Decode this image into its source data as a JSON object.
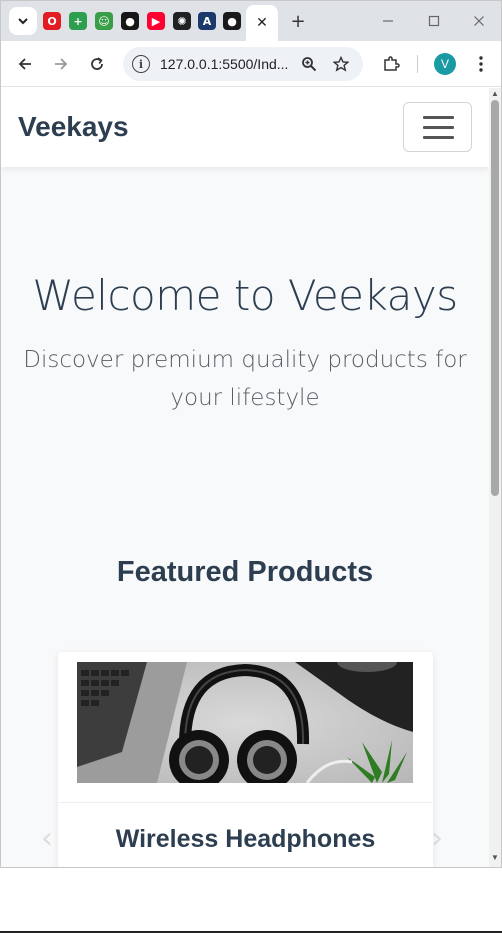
{
  "browser": {
    "pinned_tabs": [
      {
        "icon": "opera-red-icon",
        "color": "#e31b23",
        "glyph": "O"
      },
      {
        "icon": "green-plus-app-icon",
        "color": "#2e9e4f",
        "glyph": "+"
      },
      {
        "icon": "green-mascot-app-icon",
        "color": "#3a9d47",
        "glyph": "☺"
      },
      {
        "icon": "github-icon",
        "color": "#181717",
        "glyph": "●"
      },
      {
        "icon": "youtube-icon",
        "color": "#ff0033",
        "glyph": "▶"
      },
      {
        "icon": "openai-icon",
        "color": "#202123",
        "glyph": "✺"
      },
      {
        "icon": "app-store-icon",
        "color": "#1b3a6b",
        "glyph": "A"
      },
      {
        "icon": "dark-circle-app-icon",
        "color": "#1a1a1a",
        "glyph": "●"
      }
    ],
    "active_tab_close": "✕",
    "new_tab": "+",
    "url": "127.0.0.1:5500/Ind...",
    "profile_initial": "V",
    "profile_color": "#1a9aa3"
  },
  "page": {
    "brand": "Veekays",
    "hero": {
      "title": "Welcome to Veekays",
      "subtitle": "Discover premium quality products for your lifestyle"
    },
    "featured": {
      "heading": "Featured Products",
      "product": {
        "image_icon": "headphones-photo",
        "name": "Wireless Headphones"
      },
      "prev_arrow": "‹",
      "next_arrow": "›"
    }
  },
  "colors": {
    "heading": "#2c3e50",
    "page_bg": "#f8f9fa"
  }
}
